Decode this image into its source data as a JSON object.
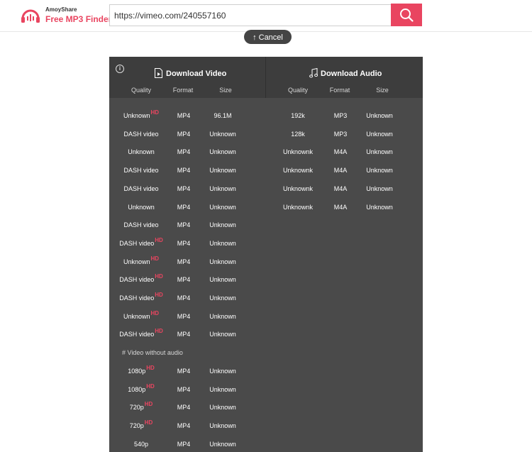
{
  "header": {
    "brand_top": "AmoyShare",
    "brand_main": "Free MP3 Finder",
    "search_value": "https://vimeo.com/240557160",
    "accent_color": "#e94560"
  },
  "cancel_label": "Cancel",
  "panel": {
    "video_title": "Download Video",
    "audio_title": "Download Audio",
    "columns": {
      "quality": "Quality",
      "format": "Format",
      "size": "Size"
    },
    "hd_badge": "HD",
    "video_rows": [
      {
        "quality": "Unknown",
        "hd": true,
        "format": "MP4",
        "size": "96.1M"
      },
      {
        "quality": "DASH video",
        "hd": false,
        "format": "MP4",
        "size": "Unknown"
      },
      {
        "quality": "Unknown",
        "hd": false,
        "format": "MP4",
        "size": "Unknown"
      },
      {
        "quality": "DASH video",
        "hd": false,
        "format": "MP4",
        "size": "Unknown"
      },
      {
        "quality": "DASH video",
        "hd": false,
        "format": "MP4",
        "size": "Unknown"
      },
      {
        "quality": "Unknown",
        "hd": false,
        "format": "MP4",
        "size": "Unknown"
      },
      {
        "quality": "DASH video",
        "hd": false,
        "format": "MP4",
        "size": "Unknown"
      },
      {
        "quality": "DASH video",
        "hd": true,
        "format": "MP4",
        "size": "Unknown"
      },
      {
        "quality": "Unknown",
        "hd": true,
        "format": "MP4",
        "size": "Unknown"
      },
      {
        "quality": "DASH video",
        "hd": true,
        "format": "MP4",
        "size": "Unknown"
      },
      {
        "quality": "DASH video",
        "hd": true,
        "format": "MP4",
        "size": "Unknown"
      },
      {
        "quality": "Unknown",
        "hd": true,
        "format": "MP4",
        "size": "Unknown"
      },
      {
        "quality": "DASH video",
        "hd": true,
        "format": "MP4",
        "size": "Unknown"
      }
    ],
    "no_audio_label": "# Video without audio",
    "no_audio_rows": [
      {
        "quality": "1080p",
        "hd": true,
        "format": "MP4",
        "size": "Unknown"
      },
      {
        "quality": "1080p",
        "hd": true,
        "format": "MP4",
        "size": "Unknown"
      },
      {
        "quality": "720p",
        "hd": true,
        "format": "MP4",
        "size": "Unknown"
      },
      {
        "quality": "720p",
        "hd": true,
        "format": "MP4",
        "size": "Unknown"
      },
      {
        "quality": "540p",
        "hd": false,
        "format": "MP4",
        "size": "Unknown"
      }
    ],
    "audio_rows": [
      {
        "quality": "192k",
        "format": "MP3",
        "size": "Unknown"
      },
      {
        "quality": "128k",
        "format": "MP3",
        "size": "Unknown"
      },
      {
        "quality": "Unknownk",
        "format": "M4A",
        "size": "Unknown"
      },
      {
        "quality": "Unknownk",
        "format": "M4A",
        "size": "Unknown"
      },
      {
        "quality": "Unknownk",
        "format": "M4A",
        "size": "Unknown"
      },
      {
        "quality": "Unknownk",
        "format": "M4A",
        "size": "Unknown"
      }
    ]
  }
}
